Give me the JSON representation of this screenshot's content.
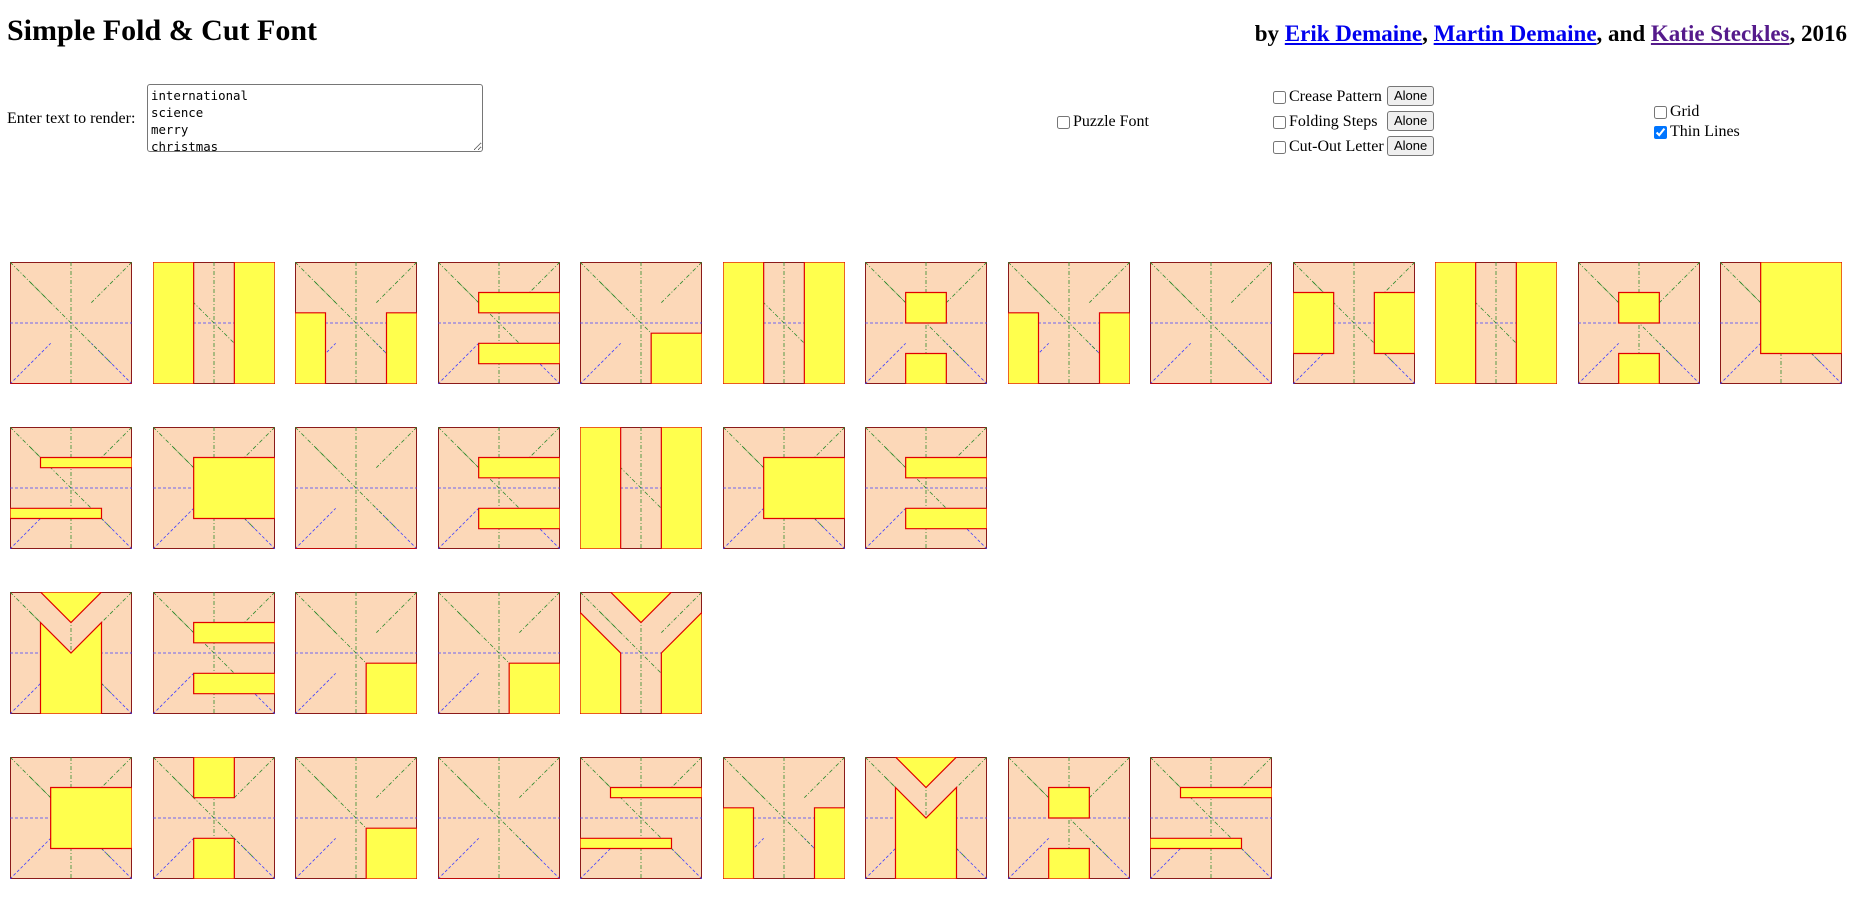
{
  "header": {
    "title": "Simple Fold & Cut Font",
    "by": "by",
    "author1": "Erik Demaine",
    "sep1": ",",
    "author2": "Martin Demaine",
    "sep2": ", and",
    "author3": "Katie Steckles",
    "year": ", 2016"
  },
  "input": {
    "label": "Enter text to render:",
    "value": "international\nscience\nmerry\nchristmas"
  },
  "options": {
    "puzzle_font": {
      "label": "Puzzle Font",
      "checked": false
    },
    "crease_pattern": {
      "label": "Crease Pattern",
      "checked": false,
      "button": "Alone"
    },
    "folding_steps": {
      "label": "Folding Steps",
      "checked": false,
      "button": "Alone"
    },
    "cut_out_letter": {
      "label": "Cut-Out Letter",
      "checked": false,
      "button": "Alone"
    },
    "grid": {
      "label": "Grid",
      "checked": false
    },
    "thin_lines": {
      "label": "Thin Lines",
      "checked": true
    }
  },
  "colors": {
    "paper": "#fcd8b8",
    "letter": "#ffff4d",
    "cut": "#e00000",
    "border": "#8b1a1a",
    "mountain": "#2e8b2e",
    "valley": "#4040ff"
  },
  "lines": [
    [
      "i",
      "n",
      "t",
      "e",
      "r",
      "n",
      "a",
      "t",
      "i",
      "o",
      "n",
      "a",
      "l"
    ],
    [
      "s",
      "c",
      "i",
      "e",
      "n",
      "c",
      "e"
    ],
    [
      "m",
      "e",
      "r",
      "r",
      "y"
    ],
    [
      "c",
      "h",
      "r",
      "i",
      "s",
      "t",
      "m",
      "a",
      "s"
    ]
  ]
}
